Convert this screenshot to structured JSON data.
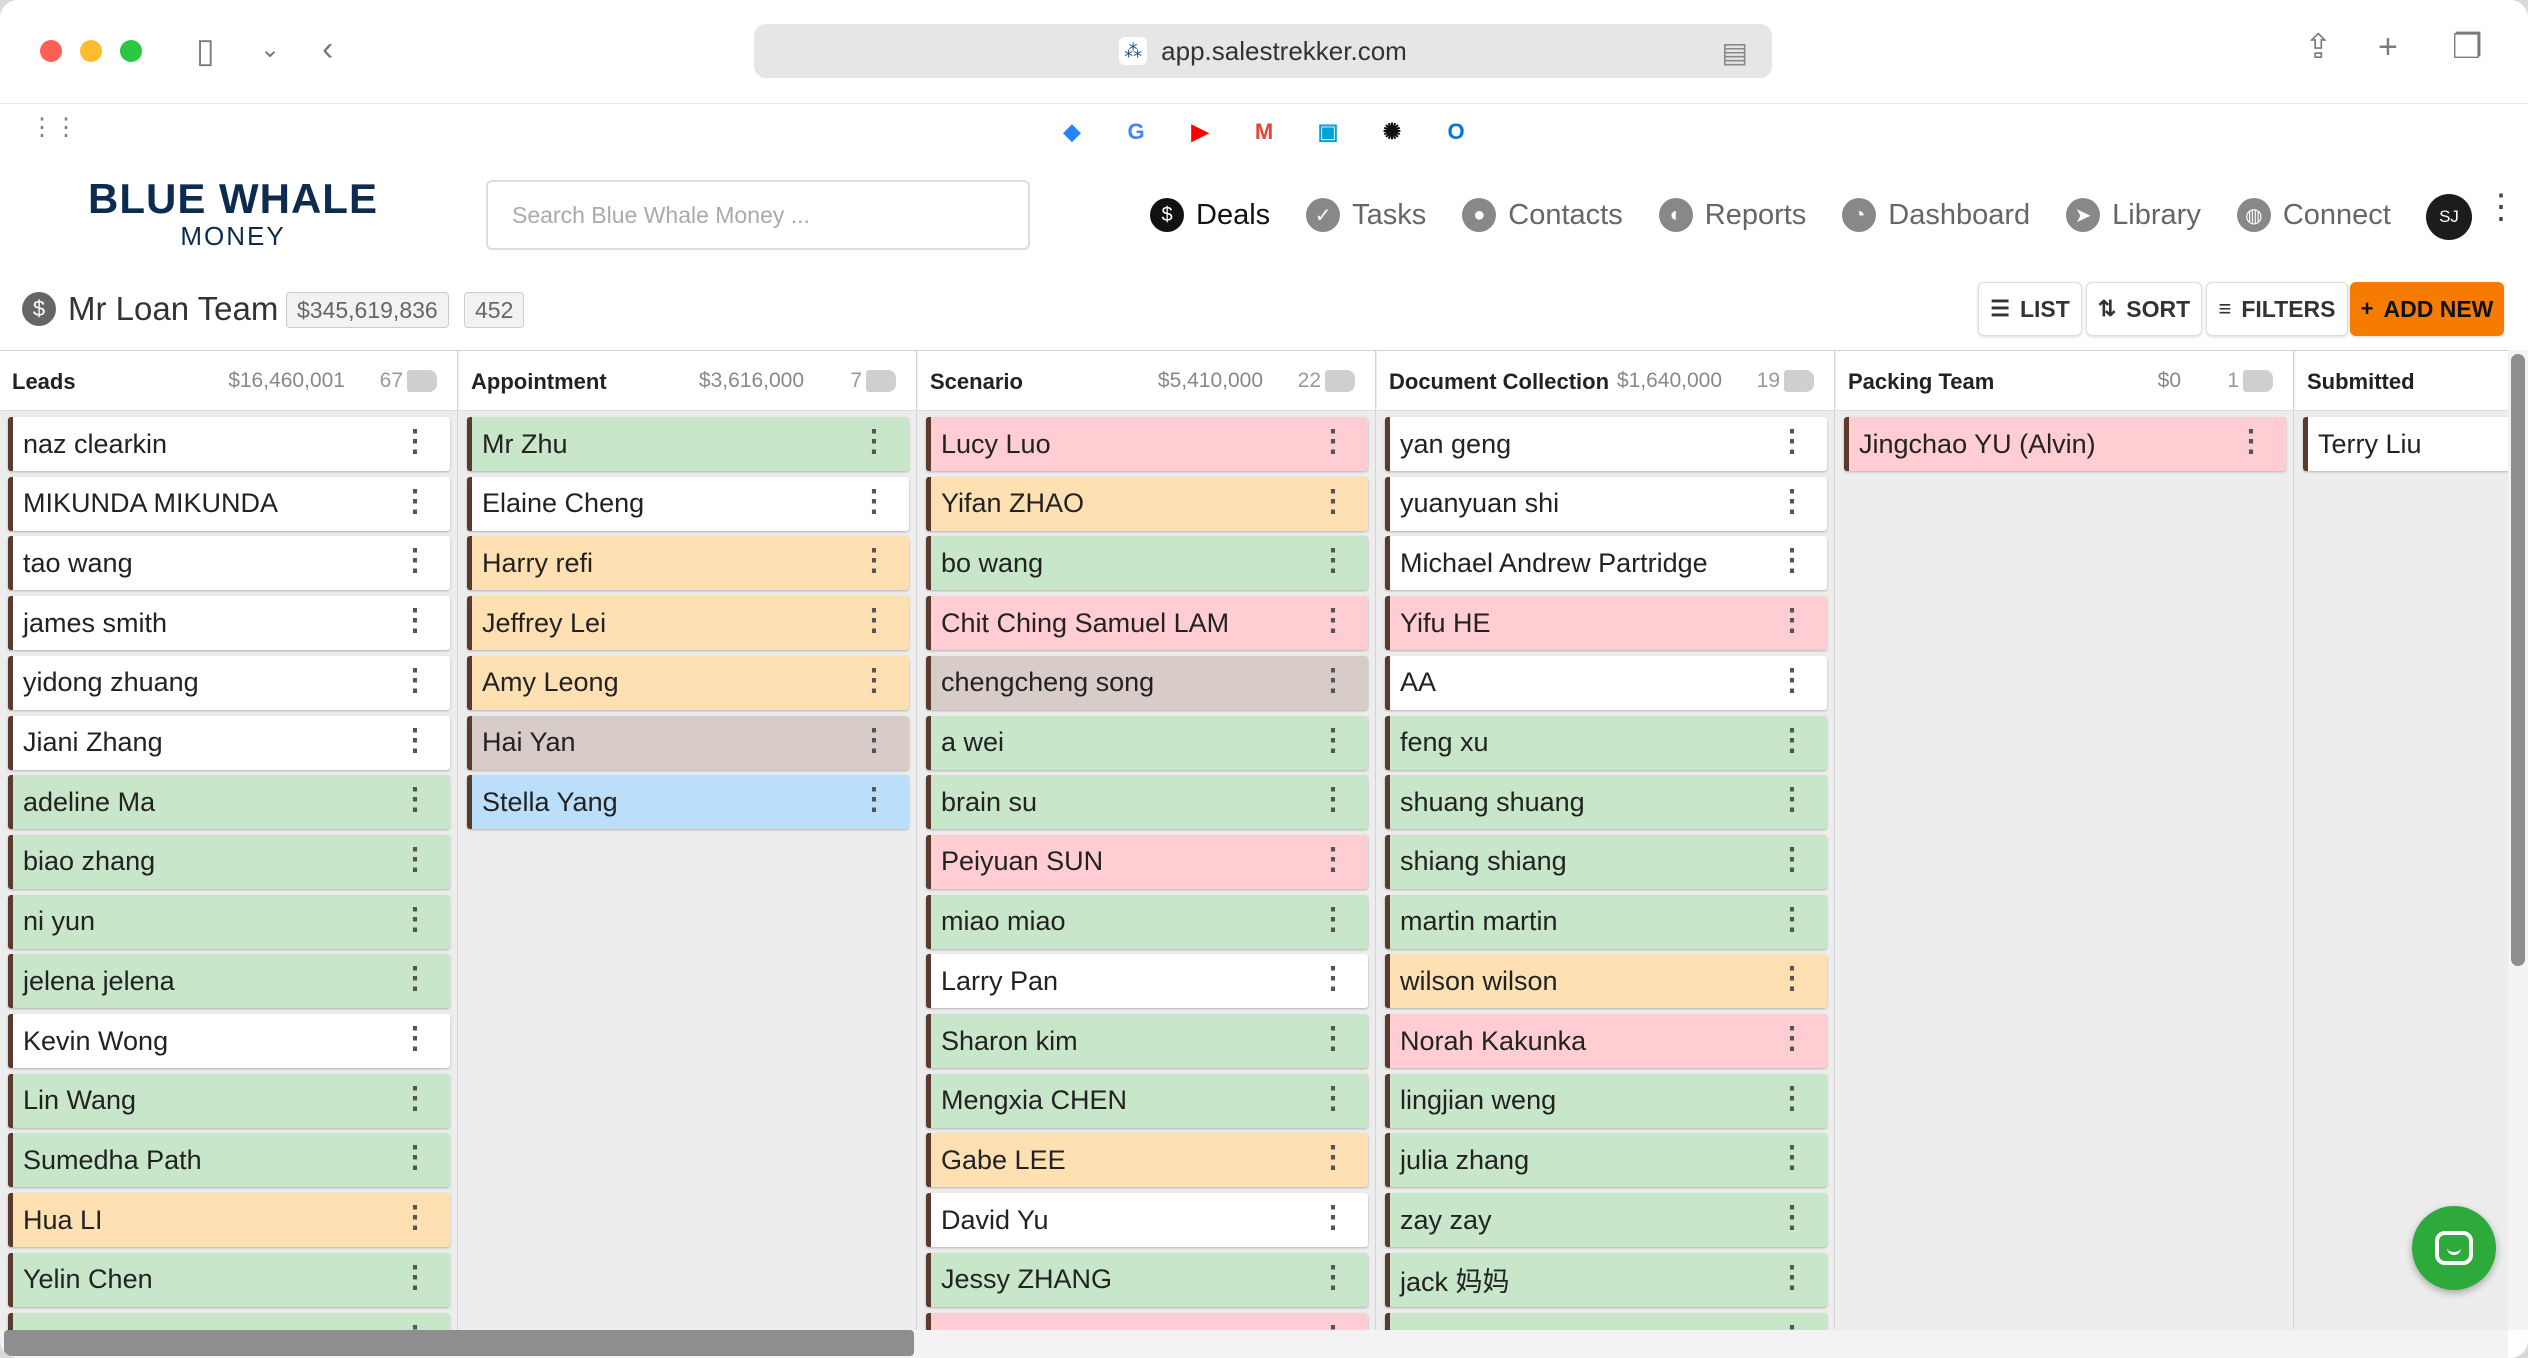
{
  "browser": {
    "url": "app.salestrekker.com",
    "bookmarks": [
      {
        "name": "jira-icon",
        "glyph": "◆",
        "color": "#2684ff"
      },
      {
        "name": "google-icon",
        "glyph": "G",
        "color": "#4285f4"
      },
      {
        "name": "youtube-icon",
        "glyph": "▶",
        "color": "#ff0000"
      },
      {
        "name": "gmail-icon",
        "glyph": "M",
        "color": "#ea4335"
      },
      {
        "name": "bilibili-icon",
        "glyph": "▣",
        "color": "#00a1d6"
      },
      {
        "name": "openai-icon",
        "glyph": "✺",
        "color": "#111111"
      },
      {
        "name": "outlook-icon",
        "glyph": "O",
        "color": "#0078d4"
      }
    ]
  },
  "app": {
    "logo_line1": "BLUE WHALE",
    "logo_line2": "MONEY",
    "search_placeholder": "Search Blue Whale Money ...",
    "nav": [
      {
        "label": "Deals",
        "icon": "dollar-icon",
        "glyph": "$",
        "active": true
      },
      {
        "label": "Tasks",
        "icon": "check-icon",
        "glyph": "✓",
        "active": false
      },
      {
        "label": "Contacts",
        "icon": "person-icon",
        "glyph": "●",
        "active": false
      },
      {
        "label": "Reports",
        "icon": "reports-icon",
        "glyph": "◐",
        "active": false
      },
      {
        "label": "Dashboard",
        "icon": "dashboard-icon",
        "glyph": "◔",
        "active": false
      },
      {
        "label": "Library",
        "icon": "compass-icon",
        "glyph": "➤",
        "active": false
      },
      {
        "label": "Connect",
        "icon": "globe-icon",
        "glyph": "◍",
        "active": false
      }
    ],
    "user_initials": "SJ"
  },
  "team": {
    "title": "Mr Loan Team",
    "total": "$345,619,836",
    "count": "452",
    "buttons": {
      "list": "LIST",
      "sort": "SORT",
      "filters": "FILTERS",
      "add_new": "ADD NEW"
    }
  },
  "colors": {
    "accent": "#f57c00",
    "white": "#ffffff",
    "green": "#c8e6c9",
    "orange": "#ffe0b2",
    "pink": "#ffcdd2",
    "taupe": "#d7ccc8",
    "blue": "#bbdefb"
  },
  "columns": [
    {
      "name": "Leads",
      "amount": "$16,460,001",
      "count": "67",
      "cards": [
        {
          "name": "naz clearkin",
          "color": "white"
        },
        {
          "name": "MIKUNDA MIKUNDA",
          "color": "white"
        },
        {
          "name": "tao wang",
          "color": "white"
        },
        {
          "name": "james smith",
          "color": "white"
        },
        {
          "name": "yidong zhuang",
          "color": "white"
        },
        {
          "name": "Jiani Zhang",
          "color": "white"
        },
        {
          "name": "adeline Ma",
          "color": "green"
        },
        {
          "name": "biao zhang",
          "color": "green"
        },
        {
          "name": "ni yun",
          "color": "green"
        },
        {
          "name": "jelena jelena",
          "color": "green"
        },
        {
          "name": "Kevin Wong",
          "color": "white"
        },
        {
          "name": "Lin Wang",
          "color": "green"
        },
        {
          "name": "Sumedha Path",
          "color": "green"
        },
        {
          "name": "Hua LI",
          "color": "orange"
        },
        {
          "name": "Yelin Chen",
          "color": "green"
        },
        {
          "name": "",
          "color": "green"
        }
      ]
    },
    {
      "name": "Appointment",
      "amount": "$3,616,000",
      "count": "7",
      "cards": [
        {
          "name": "Mr Zhu",
          "color": "green"
        },
        {
          "name": "Elaine Cheng",
          "color": "white"
        },
        {
          "name": "Harry refi",
          "color": "orange"
        },
        {
          "name": "Jeffrey Lei",
          "color": "orange"
        },
        {
          "name": "Amy Leong",
          "color": "orange"
        },
        {
          "name": "Hai Yan",
          "color": "taupe"
        },
        {
          "name": "Stella Yang",
          "color": "blue"
        }
      ]
    },
    {
      "name": "Scenario",
      "amount": "$5,410,000",
      "count": "22",
      "cards": [
        {
          "name": "Lucy Luo",
          "color": "pink"
        },
        {
          "name": "Yifan ZHAO",
          "color": "orange"
        },
        {
          "name": "bo wang",
          "color": "green"
        },
        {
          "name": "Chit Ching Samuel LAM",
          "color": "pink"
        },
        {
          "name": "chengcheng song",
          "color": "taupe"
        },
        {
          "name": "a wei",
          "color": "green"
        },
        {
          "name": "brain su",
          "color": "green"
        },
        {
          "name": "Peiyuan SUN",
          "color": "pink"
        },
        {
          "name": "miao miao",
          "color": "green"
        },
        {
          "name": "Larry Pan",
          "color": "white"
        },
        {
          "name": "Sharon kim",
          "color": "green"
        },
        {
          "name": "Mengxia CHEN",
          "color": "green"
        },
        {
          "name": "Gabe LEE",
          "color": "orange"
        },
        {
          "name": "David Yu",
          "color": "white"
        },
        {
          "name": "Jessy ZHANG",
          "color": "green"
        },
        {
          "name": "",
          "color": "pink"
        }
      ]
    },
    {
      "name": "Document Collection",
      "amount": "$1,640,000",
      "count": "19",
      "cards": [
        {
          "name": "yan geng",
          "color": "white"
        },
        {
          "name": "yuanyuan shi",
          "color": "white"
        },
        {
          "name": "Michael Andrew Partridge",
          "color": "white"
        },
        {
          "name": "Yifu HE",
          "color": "pink"
        },
        {
          "name": "AA",
          "color": "white"
        },
        {
          "name": "feng xu",
          "color": "green"
        },
        {
          "name": "shuang shuang",
          "color": "green"
        },
        {
          "name": "shiang shiang",
          "color": "green"
        },
        {
          "name": "martin martin",
          "color": "green"
        },
        {
          "name": "wilson wilson",
          "color": "orange"
        },
        {
          "name": "Norah Kakunka",
          "color": "pink"
        },
        {
          "name": "lingjian weng",
          "color": "green"
        },
        {
          "name": "julia zhang",
          "color": "green"
        },
        {
          "name": "zay zay",
          "color": "green"
        },
        {
          "name": "jack 妈妈",
          "color": "green"
        },
        {
          "name": "",
          "color": "green"
        }
      ]
    },
    {
      "name": "Packing Team",
      "amount": "$0",
      "count": "1",
      "cards": [
        {
          "name": "Jingchao YU (Alvin)",
          "color": "pink"
        }
      ]
    },
    {
      "name": "Submitted",
      "amount": "",
      "count": "",
      "cards": [
        {
          "name": "Terry Liu",
          "color": "white"
        }
      ]
    }
  ]
}
